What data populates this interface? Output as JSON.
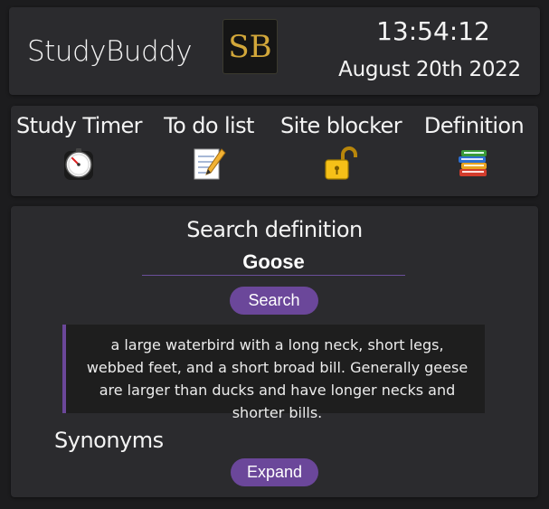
{
  "header": {
    "app_title": "StudyBuddy",
    "logo_text": "SB",
    "time": "13:54:12",
    "date": "August 20th 2022"
  },
  "nav": {
    "items": [
      {
        "label": "Study Timer",
        "icon": "stopwatch-icon"
      },
      {
        "label": "To do list",
        "icon": "memo-icon"
      },
      {
        "label": "Site blocker",
        "icon": "lock-icon"
      },
      {
        "label": "Definition",
        "icon": "books-icon"
      }
    ]
  },
  "search": {
    "title": "Search definition",
    "value": "Goose",
    "button_label": "Search"
  },
  "definition": {
    "text": "a large waterbird with a long neck, short legs, webbed feet, and a short broad bill. Generally geese are larger than ducks and have longer necks and shorter bills."
  },
  "synonyms": {
    "title": "Synonyms",
    "button_label": "Expand"
  },
  "colors": {
    "background": "#1c1c1e",
    "card": "#2b2b2e",
    "accent": "#6b479a",
    "logo_gold": "#d2a73a"
  }
}
